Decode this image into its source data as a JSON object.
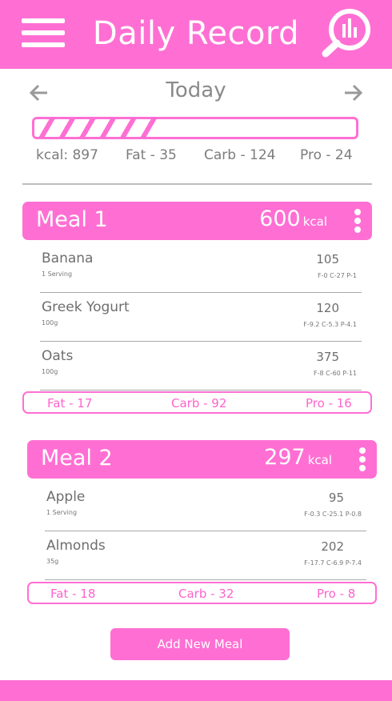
{
  "header": {
    "title": "Daily Record",
    "menu_icon": "hamburger-menu-icon",
    "stats_icon": "search-stats-icon"
  },
  "date_nav": {
    "label": "Today",
    "prev_icon": "arrow-left-icon",
    "next_icon": "arrow-right-icon"
  },
  "daily_progress": 0.38,
  "totals": {
    "kcal": "kcal: 897",
    "fat": "Fat - 35",
    "carb": "Carb - 124",
    "pro": "Pro  - 24"
  },
  "meals": [
    {
      "title": "Meal 1",
      "kcal": "600",
      "kcal_unit": "kcal",
      "items": [
        {
          "name": "Banana",
          "serving": "1 Serving",
          "calories": "105",
          "macros": "F-0 C-27 P-1"
        },
        {
          "name": "Greek Yogurt",
          "serving": "100g",
          "calories": "120",
          "macros": "F-9.2 C-5.3 P-4.1"
        },
        {
          "name": "Oats",
          "serving": "100g",
          "calories": "375",
          "macros": "F-8 C-60 P-11"
        }
      ],
      "summary": {
        "fat": "Fat - 17",
        "carb": "Carb - 92",
        "pro": "Pro - 16"
      }
    },
    {
      "title": "Meal 2",
      "kcal": "297",
      "kcal_unit": "kcal",
      "items": [
        {
          "name": "Apple",
          "serving": "1 Serving",
          "calories": "95",
          "macros": "F-0.3 C-25.1 P-0.8"
        },
        {
          "name": "Almonds",
          "serving": "35g",
          "calories": "202",
          "macros": "F-17.7 C-6.9 P-7.4"
        }
      ],
      "summary": {
        "fat": "Fat - 18",
        "carb": "Carb - 32",
        "pro": "Pro - 8"
      }
    }
  ],
  "add_button": {
    "label": "Add New Meal"
  },
  "colors": {
    "accent": "#ff6fd3",
    "text": "#7a7a7a",
    "divider": "#bdbdbd"
  }
}
